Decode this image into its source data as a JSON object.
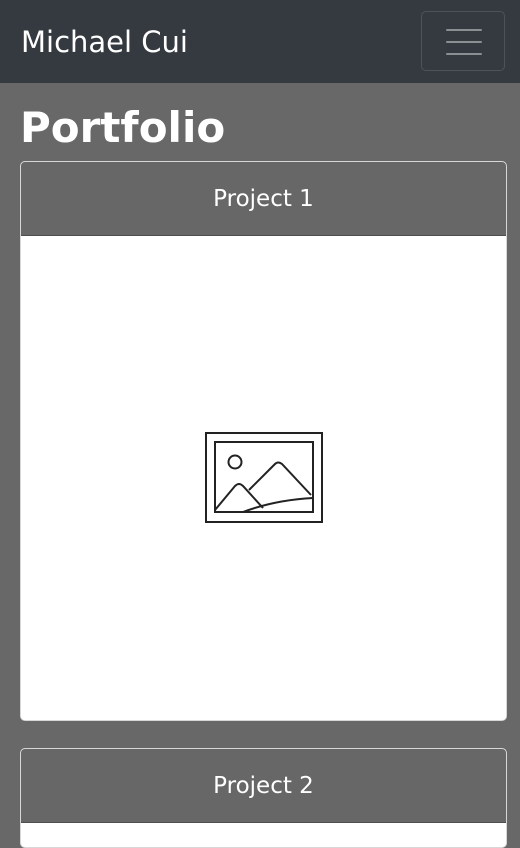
{
  "navbar": {
    "brand": "Michael Cui",
    "toggler_icon": "hamburger-menu-icon"
  },
  "main": {
    "title": "Portfolio",
    "projects": [
      {
        "title": "Project 1",
        "image_icon": "image-placeholder-icon"
      },
      {
        "title": "Project 2"
      }
    ]
  },
  "colors": {
    "navbar_bg": "#343a40",
    "page_bg": "#686868",
    "card_header_bg": "#676767",
    "card_body_bg": "#ffffff"
  }
}
